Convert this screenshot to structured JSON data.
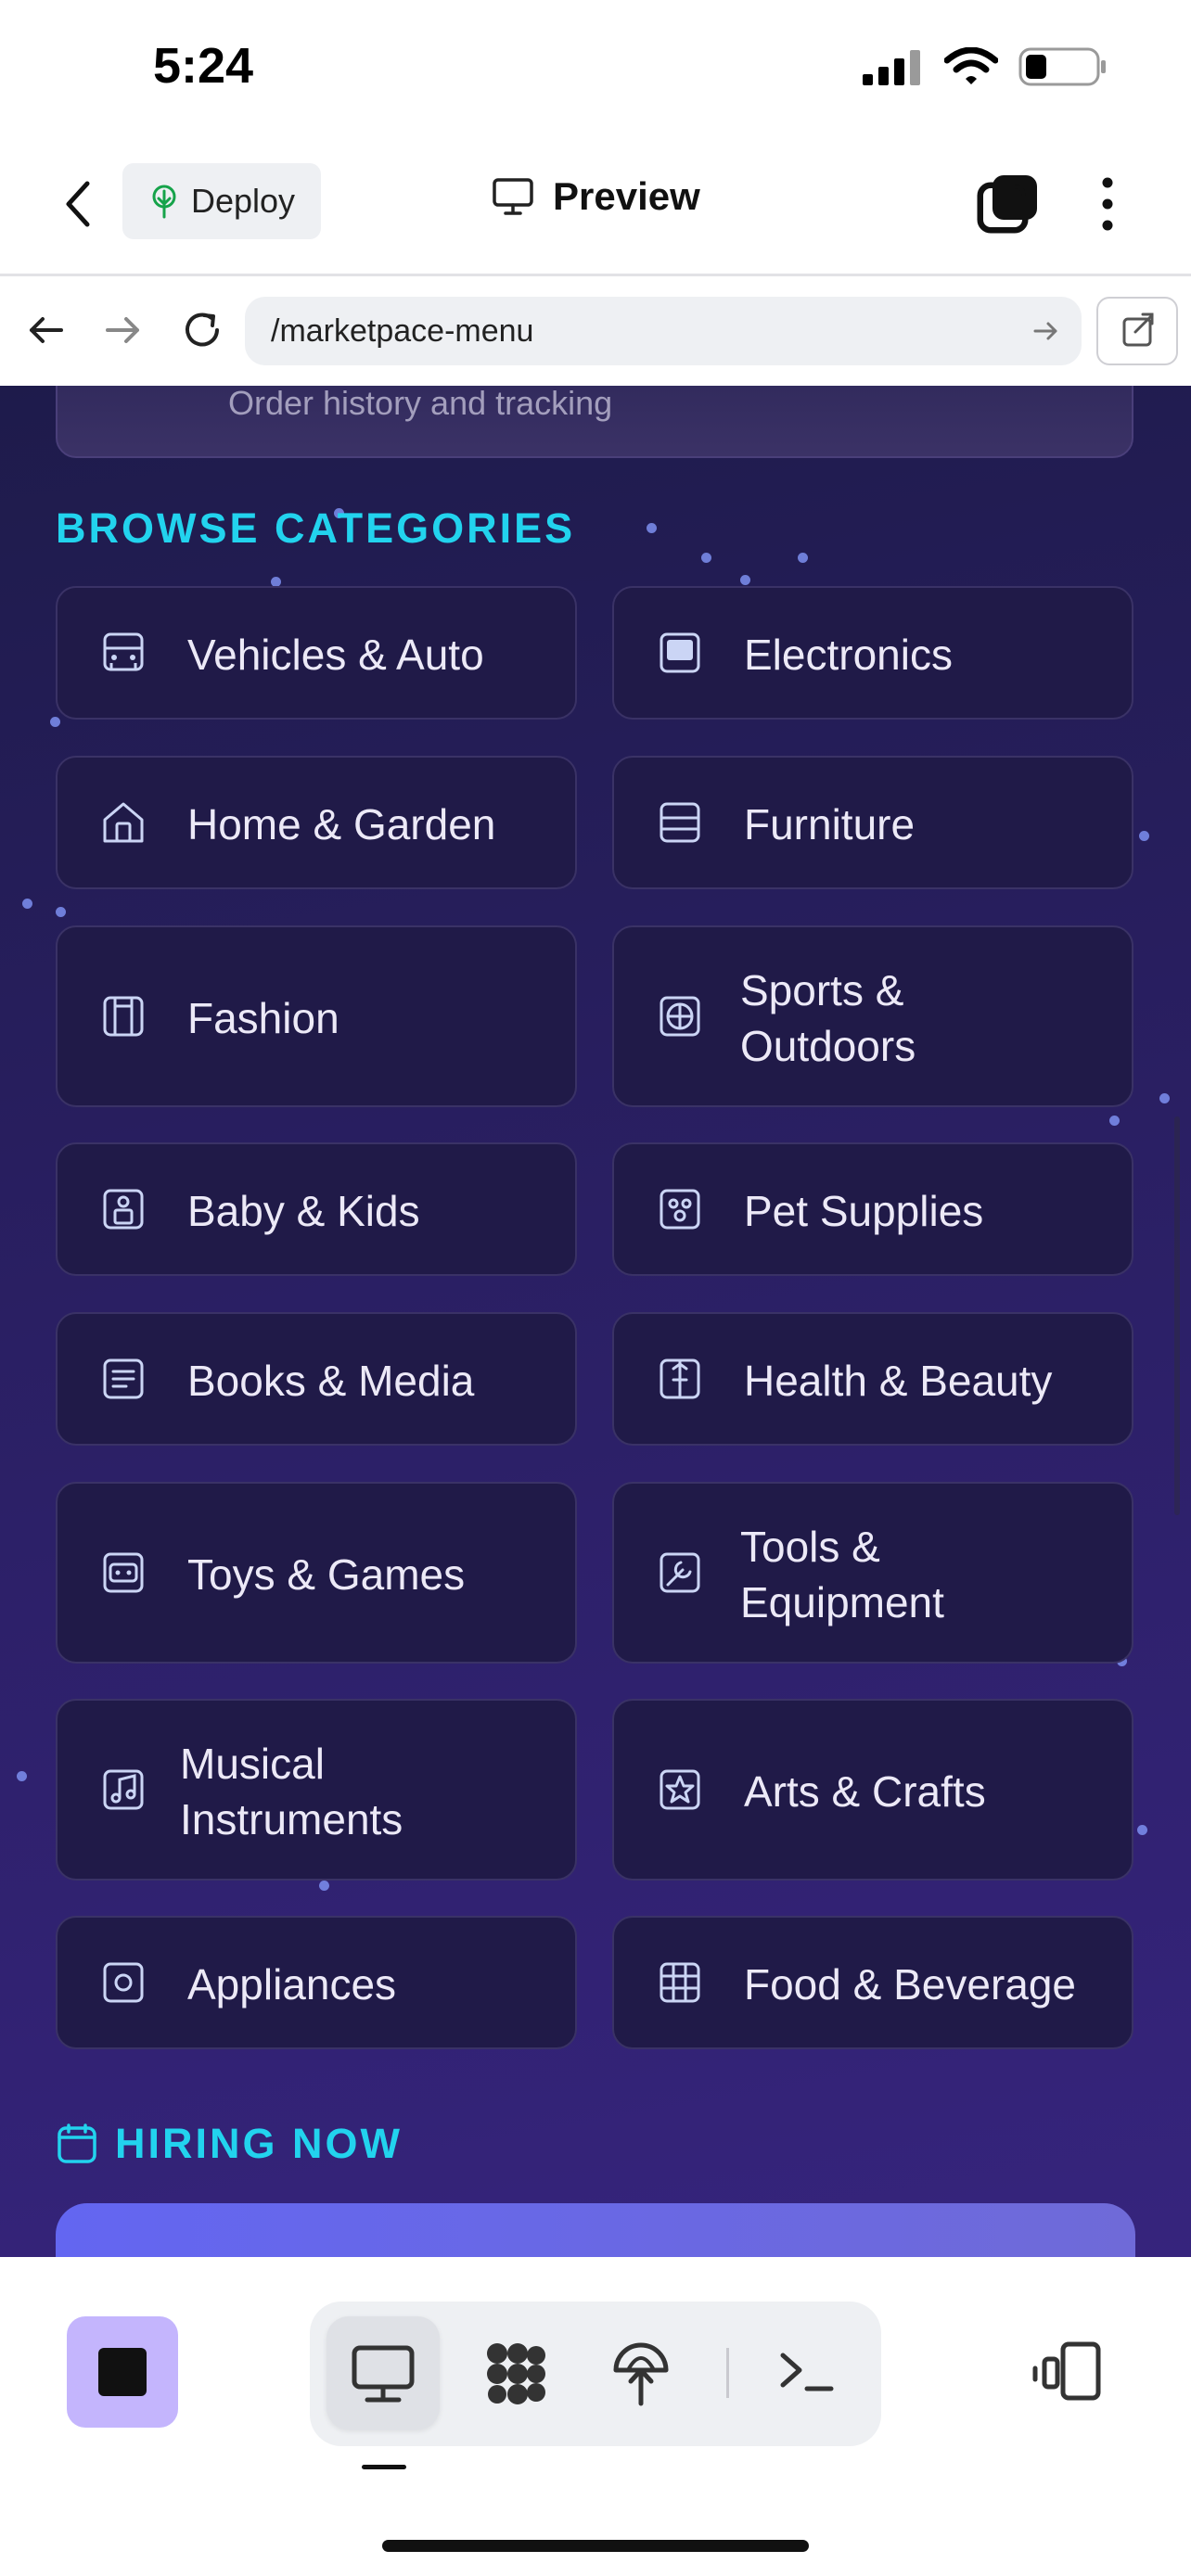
{
  "status_bar": {
    "time": "5:24"
  },
  "header": {
    "deploy_label": "Deploy",
    "preview_label": "Preview"
  },
  "browser": {
    "url": "/marketpace-menu"
  },
  "previous_card": {
    "subtitle": "Order history and tracking"
  },
  "categories_section": {
    "title": "BROWSE CATEGORIES",
    "items": [
      {
        "label": "Vehicles & Auto",
        "icon": "car-icon"
      },
      {
        "label": "Electronics",
        "icon": "monitor-icon"
      },
      {
        "label": "Home & Garden",
        "icon": "house-icon"
      },
      {
        "label": "Furniture",
        "icon": "cabinet-icon"
      },
      {
        "label": "Fashion",
        "icon": "shirt-icon"
      },
      {
        "label": "Sports &\nOutdoors",
        "icon": "ball-icon"
      },
      {
        "label": "Baby & Kids",
        "icon": "baby-icon"
      },
      {
        "label": "Pet Supplies",
        "icon": "paw-icon"
      },
      {
        "label": "Books & Media",
        "icon": "book-icon"
      },
      {
        "label": "Health & Beauty",
        "icon": "health-icon"
      },
      {
        "label": "Toys & Games",
        "icon": "gamepad-icon"
      },
      {
        "label": "Tools &\nEquipment",
        "icon": "wrench-icon"
      },
      {
        "label": "Musical\nInstruments",
        "icon": "music-icon"
      },
      {
        "label": "Arts & Crafts",
        "icon": "star-icon"
      },
      {
        "label": "Appliances",
        "icon": "appliance-icon"
      },
      {
        "label": "Food & Beverage",
        "icon": "grid-icon"
      }
    ]
  },
  "hiring_section": {
    "title": "HIRING NOW",
    "icon": "calendar-icon"
  },
  "colors": {
    "accent": "#22d3ee",
    "background": "#1e1b4b",
    "card": "#201a48",
    "hiring_card": "#6366f1"
  }
}
